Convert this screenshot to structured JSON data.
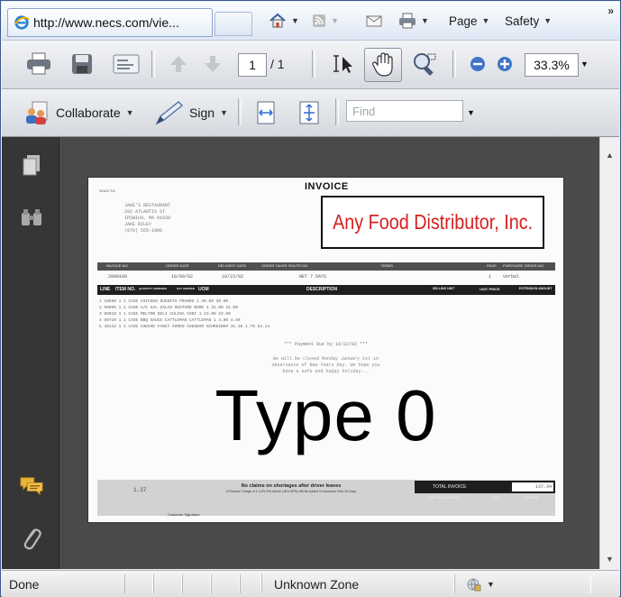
{
  "browser": {
    "tab_url": "http://www.necs.com/vie...",
    "commands": [
      {
        "label": "Page"
      },
      {
        "label": "Safety"
      }
    ],
    "overflow": "»"
  },
  "toolbar": {
    "page_current": "1",
    "page_total": "/ 1",
    "zoom": "33.3%"
  },
  "toolbar2": {
    "collaborate": "Collaborate",
    "sign": "Sign",
    "find_placeholder": "Find"
  },
  "document": {
    "title": "INVOICE",
    "sold_to_label": "SOLD TO:",
    "address": "JAKE'S RESTAURANT\n292 ATLANTIS ST\nIPSWICH, MA 01938\nJAKE RILEY\n(978) 555-1000",
    "company": "Any Food Distributor, Inc.",
    "header_labels": [
      "INVOICE NO.",
      "ORDER DATE",
      "DELIVERY DATE",
      "ORDER TAKER",
      "ROUTE NO.",
      "TERMS",
      "PAGE",
      "PURCHASE ORDER NO."
    ],
    "header_values": [
      "2000160",
      "10/09/02",
      "10/15/02",
      "NET 7 DAYS",
      "1",
      "Verbal"
    ],
    "column_labels": [
      "LINE",
      "ITEM NO.",
      "QUANTITY ORDERED",
      "QTY SHIPPED",
      "UOM",
      "DESCRIPTION",
      "SELLING UNIT",
      "UNIT PRICE",
      "EXTENSION AMOUNT"
    ],
    "line_items": [
      "1  10690   1   1   CASE  CHICKEN NUGGETS              PRANDO         1      30.00     30.00",
      "2  50006   1   1   CASE  A/E GAL SALAD MUSTARD        BORD           1      31.00     31.00",
      "3  90010   1   1   CASE  MELTON DELI                  CULINA CHEF    1      23.00     23.00",
      "4  50710   1   1   CASE  BBQ SAUCE CATTLEMAN          CATTLEMAN      1       4.80      4.80",
      "5  40122   1   1   CASE  CHEESE FANCY SHRED CHEDDAR   SCHREIBER  31.35    1.70     53.14"
    ],
    "payment_due": "*** Payment Due by 10/22/02 ***",
    "notice": "We will be closed Monday January 1st in\nobservance of New Years Day. We hope you\nhave a safe and happy holiday...",
    "watermark": "Type 0",
    "footer_amount": "1.37",
    "footer_message": "No claims on shortages after driver leaves",
    "footer_sub": "A Finance Charge of 1-1/2% Per Month (18% APR) Will Be Added To Accounts Over 30 Days",
    "signature_label": "Customer Signature",
    "total_label": "TOTAL INVOICE",
    "total_value": "137.34",
    "sub_labels": [
      "PAID ON ACCOUNT",
      "CASH",
      "CHARGE"
    ]
  },
  "status": {
    "left": "Done",
    "zone": "Unknown Zone"
  }
}
